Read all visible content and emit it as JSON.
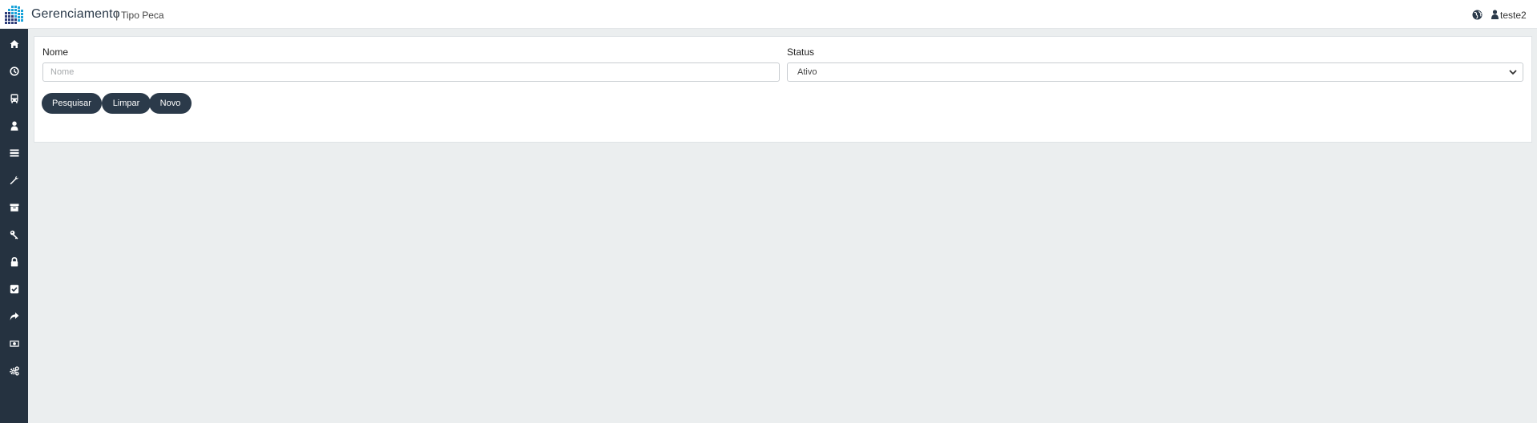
{
  "header": {
    "app_title": "Gerenciamento",
    "separator": "|",
    "page_name": "Tipo Peca",
    "user_name": "teste2"
  },
  "sidebar": {
    "items": [
      {
        "icon": "home-icon"
      },
      {
        "icon": "dashboard-icon"
      },
      {
        "icon": "bus-icon"
      },
      {
        "icon": "user-icon"
      },
      {
        "icon": "list-icon"
      },
      {
        "icon": "wrench-icon"
      },
      {
        "icon": "archive-icon"
      },
      {
        "icon": "key-icon"
      },
      {
        "icon": "lock-icon"
      },
      {
        "icon": "checkbox-icon"
      },
      {
        "icon": "share-icon"
      },
      {
        "icon": "money-icon"
      },
      {
        "icon": "cogs-icon"
      }
    ]
  },
  "filters": {
    "nome_label": "Nome",
    "nome_placeholder": "Nome",
    "nome_value": "",
    "status_label": "Status",
    "status_value": "Ativo"
  },
  "actions": {
    "search_label": "Pesquisar",
    "clear_label": "Limpar",
    "new_label": "Novo"
  },
  "colors": {
    "sidebar_bg": "#253240",
    "button_bg": "#2b3a4a",
    "page_bg": "#ebeeef"
  }
}
